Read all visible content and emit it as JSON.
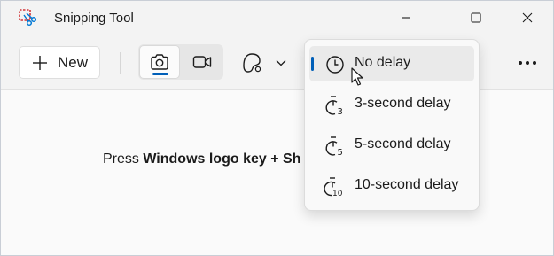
{
  "window": {
    "title": "Snipping Tool",
    "app_icon": "snipping-tool-icon",
    "controls": [
      "minimize-icon",
      "maximize-icon",
      "close-icon"
    ]
  },
  "toolbar": {
    "new_label": "New",
    "new_icon": "plus-icon",
    "modes": [
      {
        "name": "snip",
        "icon": "camera-icon",
        "active": true
      },
      {
        "name": "record",
        "icon": "video-camera-icon",
        "active": false
      }
    ],
    "shape_icon": "freeform-shape-icon",
    "shape_dropdown_icon": "chevron-down-icon",
    "more_icon": "more-ellipsis-icon"
  },
  "content": {
    "instruction_prefix": "Press ",
    "instruction_bold": "Windows logo key + Sh",
    "instruction_cut": "..."
  },
  "delay_menu": {
    "items": [
      {
        "label": "No delay",
        "icon": "clock-icon",
        "selected": true
      },
      {
        "label": "3-second delay",
        "icon": "timer-3-icon",
        "selected": false
      },
      {
        "label": "5-second delay",
        "icon": "timer-5-icon",
        "selected": false
      },
      {
        "label": "10-second delay",
        "icon": "timer-10-icon",
        "selected": false
      }
    ]
  },
  "colors": {
    "accent": "#005fb8",
    "window_bg": "#f3f3f3",
    "content_bg": "#fafafa",
    "menu_bg": "#f9f9f9",
    "app_icon_red": "#d13438",
    "app_icon_blue": "#0078d4"
  }
}
